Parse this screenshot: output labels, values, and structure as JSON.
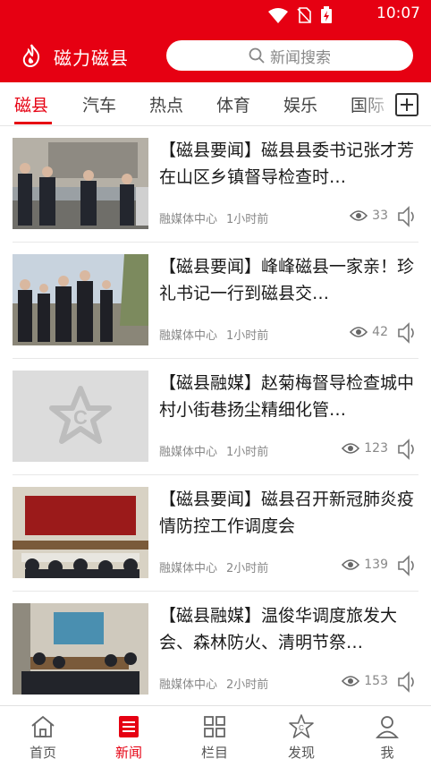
{
  "status_bar": {
    "time": "10:07"
  },
  "header": {
    "app_title": "磁力磁县",
    "search_placeholder": "新闻搜索",
    "brand_color": "#e60012"
  },
  "tabs": [
    {
      "label": "磁县",
      "active": true
    },
    {
      "label": "汽车"
    },
    {
      "label": "热点"
    },
    {
      "label": "体育"
    },
    {
      "label": "娱乐"
    },
    {
      "label": "国际"
    }
  ],
  "news": [
    {
      "title": "【磁县要闻】磁县县委书记张才芳在山区乡镇督导检查时…",
      "source": "融媒体中心",
      "time": "1小时前",
      "views": "33"
    },
    {
      "title": "【磁县要闻】峰峰磁县一家亲！珍礼书记一行到磁县交…",
      "source": "融媒体中心",
      "time": "1小时前",
      "views": "42"
    },
    {
      "title": "【磁县融媒】赵菊梅督导检查城中村小街巷扬尘精细化管…",
      "source": "融媒体中心",
      "time": "1小时前",
      "views": "123"
    },
    {
      "title": "【磁县要闻】磁县召开新冠肺炎疫情防控工作调度会",
      "source": "融媒体中心",
      "time": "2小时前",
      "views": "139"
    },
    {
      "title": "【磁县融媒】温俊华调度旅发大会、森林防火、清明节祭…",
      "source": "融媒体中心",
      "time": "2小时前",
      "views": "153"
    }
  ],
  "bottom_nav": [
    {
      "label": "首页",
      "icon": "home-icon"
    },
    {
      "label": "新闻",
      "icon": "news-icon",
      "active": true
    },
    {
      "label": "栏目",
      "icon": "grid-icon"
    },
    {
      "label": "发现",
      "icon": "discover-icon"
    },
    {
      "label": "我",
      "icon": "profile-icon"
    }
  ]
}
